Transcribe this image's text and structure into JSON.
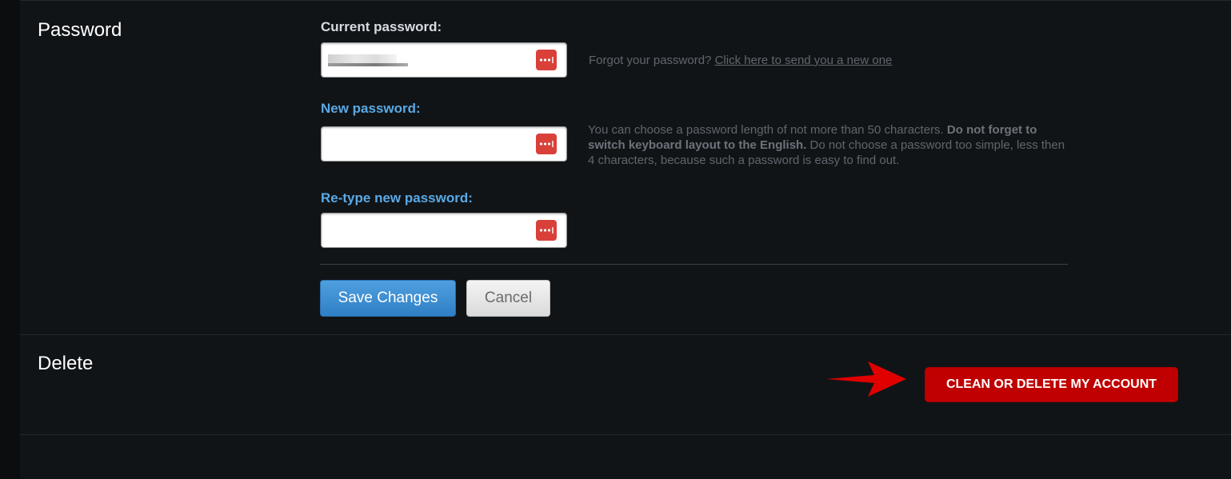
{
  "password_section": {
    "title": "Password",
    "current_password": {
      "label": "Current password:",
      "label_color": "#d6dce2",
      "value_masked": true
    },
    "forgot": {
      "text": "Forgot your password? ",
      "link": "Click here to send you a new one"
    },
    "new_password": {
      "label": "New password:",
      "label_color": "#5aa9e6",
      "value": ""
    },
    "retype_password": {
      "label": "Re-type new password:",
      "label_color": "#5aa9e6",
      "value": ""
    },
    "hint": {
      "part1": "You can choose a password length of not more than 50 characters. ",
      "bold": "Do not forget to switch keyboard layout to the English.",
      "part2": " Do not choose a password too simple, less then 4 characters, because such a password is easy to find out."
    },
    "save_label": "Save Changes",
    "cancel_label": "Cancel"
  },
  "delete_section": {
    "title": "Delete",
    "delete_button_label": "CLEAN OR DELETE MY ACCOUNT",
    "arrow_color": "#e00000",
    "button_color": "#c00000"
  },
  "icons": {
    "password_manager": "password-manager-icon",
    "arrow": "red-arrow-icon"
  }
}
